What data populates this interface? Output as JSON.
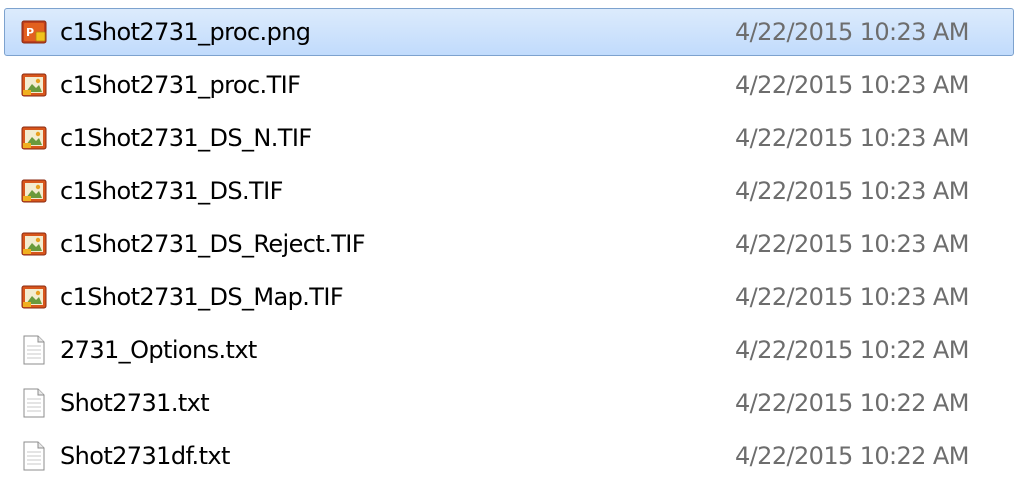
{
  "files": [
    {
      "name": "c1Shot2731_proc.png",
      "date": "4/22/2015 10:23 AM",
      "icon": "png-image-icon",
      "selected": true
    },
    {
      "name": "c1Shot2731_proc.TIF",
      "date": "4/22/2015 10:23 AM",
      "icon": "tif-image-icon",
      "selected": false
    },
    {
      "name": "c1Shot2731_DS_N.TIF",
      "date": "4/22/2015 10:23 AM",
      "icon": "tif-image-icon",
      "selected": false
    },
    {
      "name": "c1Shot2731_DS.TIF",
      "date": "4/22/2015 10:23 AM",
      "icon": "tif-image-icon",
      "selected": false
    },
    {
      "name": "c1Shot2731_DS_Reject.TIF",
      "date": "4/22/2015 10:23 AM",
      "icon": "tif-image-icon",
      "selected": false
    },
    {
      "name": "c1Shot2731_DS_Map.TIF",
      "date": "4/22/2015 10:23 AM",
      "icon": "tif-image-icon",
      "selected": false
    },
    {
      "name": "2731_Options.txt",
      "date": "4/22/2015 10:22 AM",
      "icon": "text-file-icon",
      "selected": false
    },
    {
      "name": "Shot2731.txt",
      "date": "4/22/2015 10:22 AM",
      "icon": "text-file-icon",
      "selected": false
    },
    {
      "name": "Shot2731df.txt",
      "date": "4/22/2015 10:22 AM",
      "icon": "text-file-icon",
      "selected": false
    }
  ],
  "colors": {
    "selection_top": "#dcebfc",
    "selection_bottom": "#c1dbfc",
    "selection_border": "#7da2ce",
    "date_text": "#6d6d6d"
  }
}
